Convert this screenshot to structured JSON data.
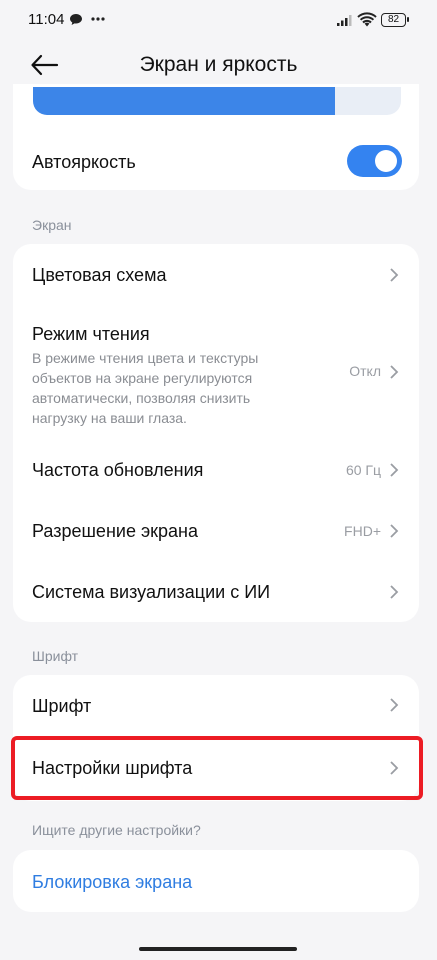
{
  "status_bar": {
    "time": "11:04",
    "battery": "82",
    "icons": [
      "chat-bubble-icon",
      "more-dots-icon",
      "signal-icon",
      "wifi-icon",
      "battery-icon"
    ]
  },
  "header": {
    "title": "Экран и яркость",
    "back_icon": "arrow-left-icon"
  },
  "brightness": {
    "level_fraction": 0.82,
    "auto_label": "Автояркость",
    "auto_enabled": true
  },
  "sections": {
    "screen": {
      "label": "Экран",
      "items": [
        {
          "title": "Цветовая схема",
          "value": ""
        },
        {
          "title": "Режим чтения",
          "description": "В режиме чтения цвета и текстуры объектов на экране регулируются автоматически, позволяя снизить нагрузку на ваши глаза.",
          "value": "Откл"
        },
        {
          "title": "Частота обновления",
          "value": "60 Гц"
        },
        {
          "title": "Разрешение экрана",
          "value": "FHD+"
        },
        {
          "title": "Система визуализации с ИИ",
          "value": ""
        }
      ]
    },
    "font": {
      "label": "Шрифт",
      "items": [
        {
          "title": "Шрифт"
        },
        {
          "title": "Настройки шрифта"
        }
      ]
    },
    "other": {
      "label": "Ищите другие настройки?",
      "items": [
        {
          "title": "Блокировка экрана"
        }
      ]
    }
  },
  "colors": {
    "accent": "#3483f0",
    "highlight": "#ec1c24",
    "link": "#2f7de1"
  }
}
